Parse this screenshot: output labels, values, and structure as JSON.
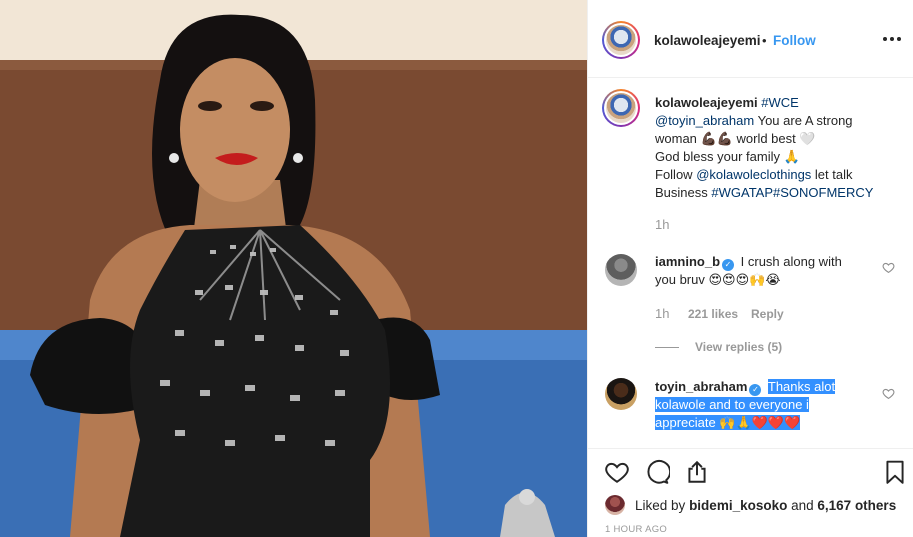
{
  "post": {
    "author": "kolawoleajeyemi",
    "follow_label": "Follow",
    "separator": "•"
  },
  "caption": {
    "author": "kolawoleajeyemi",
    "hashtag_wce": "#WCE",
    "mention_toyin": "@toyin_abraham",
    "text_1": "You are A strong woman 💪🏿💪🏿 world best 🤍",
    "text_2": "God bless your family 🙏",
    "text_3": "Follow",
    "mention_clothings": "@kolawoleclothings",
    "text_4": "let talk Business",
    "hashtags": "#WGATAP#SONOFMERCY",
    "time": "1h"
  },
  "comments": [
    {
      "username": "iamnino_b",
      "verified": true,
      "text": "I crush along with you bruv 😍😍😍🙌😭",
      "time": "1h",
      "likes": "221 likes",
      "reply_label": "Reply",
      "view_replies": "View replies (5)"
    },
    {
      "username": "toyin_abraham",
      "verified": true,
      "text": "Thanks alot kolawole and to everyone i appreciate 🙌🙏❤️❤️❤️"
    }
  ],
  "likes": {
    "prefix": "Liked by",
    "user": "bidemi_kosoko",
    "joiner": "and",
    "others": "6,167 others"
  },
  "timestamp": "1 HOUR AGO",
  "icons": {
    "like": "heart-icon",
    "comment": "comment-icon",
    "share": "share-icon",
    "save": "bookmark-icon",
    "more": "more-options-icon",
    "verified": "verified-badge-icon"
  },
  "colors": {
    "link": "#3897f0",
    "hashtag": "#003569",
    "muted": "#999999",
    "selection": "#3390ff"
  }
}
